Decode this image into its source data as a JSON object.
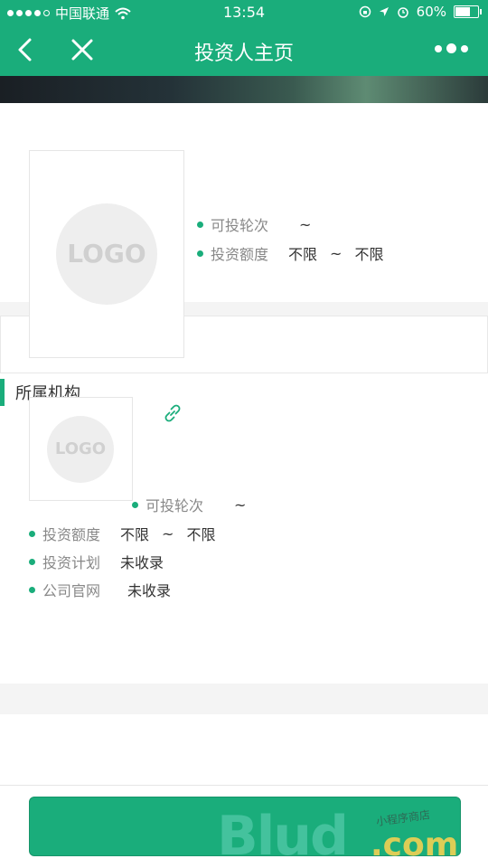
{
  "status": {
    "carrier": "中国联通",
    "time": "13:54",
    "battery": "60%"
  },
  "nav": {
    "title": "投资人主页"
  },
  "investor": {
    "logo_text": "LOGO",
    "rounds_label": "可投轮次",
    "rounds_value": "~",
    "amount_label": "投资额度",
    "amount_min": "不限",
    "amount_sep": "~",
    "amount_max": "不限"
  },
  "org": {
    "section_title": "所属机构",
    "logo_text": "LOGO",
    "rounds_label": "可投轮次",
    "rounds_value": "~",
    "amount_label": "投资额度",
    "amount_min": "不限",
    "amount_sep": "~",
    "amount_max": "不限",
    "plan_label": "投资计划",
    "plan_value": "未收录",
    "site_label": "公司官网",
    "site_value": "未收录"
  },
  "watermark": {
    "main": "Blud",
    "suffix": ".com",
    "script": "小程序商店"
  },
  "colors": {
    "brand": "#1aad7b",
    "gap_gray": "#f4f4f4"
  }
}
